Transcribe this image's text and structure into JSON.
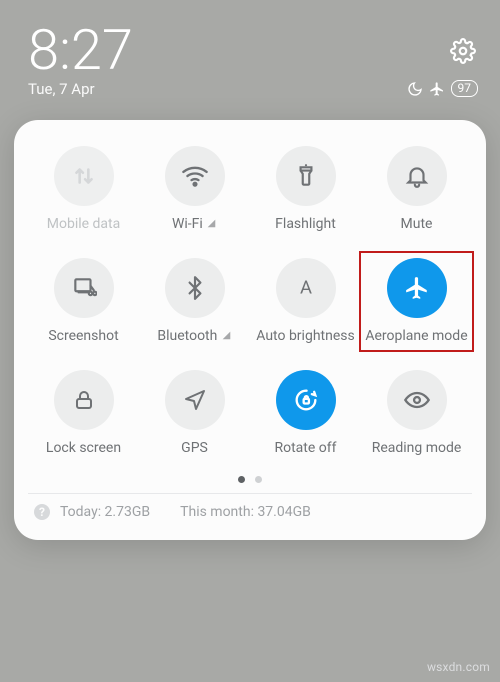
{
  "header": {
    "time": "8:27",
    "date": "Tue, 7 Apr",
    "battery_pct": "97"
  },
  "tiles": {
    "mobile_data": {
      "label": "Mobile data"
    },
    "wifi": {
      "label": "Wi-Fi"
    },
    "flashlight": {
      "label": "Flashlight"
    },
    "mute": {
      "label": "Mute"
    },
    "screenshot": {
      "label": "Screenshot"
    },
    "bluetooth": {
      "label": "Bluetooth"
    },
    "auto_brightness": {
      "label": "Auto brightness"
    },
    "aeroplane_mode": {
      "label": "Aeroplane mode"
    },
    "lock_screen": {
      "label": "Lock screen"
    },
    "gps": {
      "label": "GPS"
    },
    "rotate_off": {
      "label": "Rotate off"
    },
    "reading_mode": {
      "label": "Reading mode"
    }
  },
  "data_usage": {
    "today_label": "Today: 2.73GB",
    "month_label": "This month: 37.04GB"
  },
  "watermark": "wsxdn.com",
  "colors": {
    "accent": "#0f98eb",
    "highlight": "#c11c1b"
  }
}
